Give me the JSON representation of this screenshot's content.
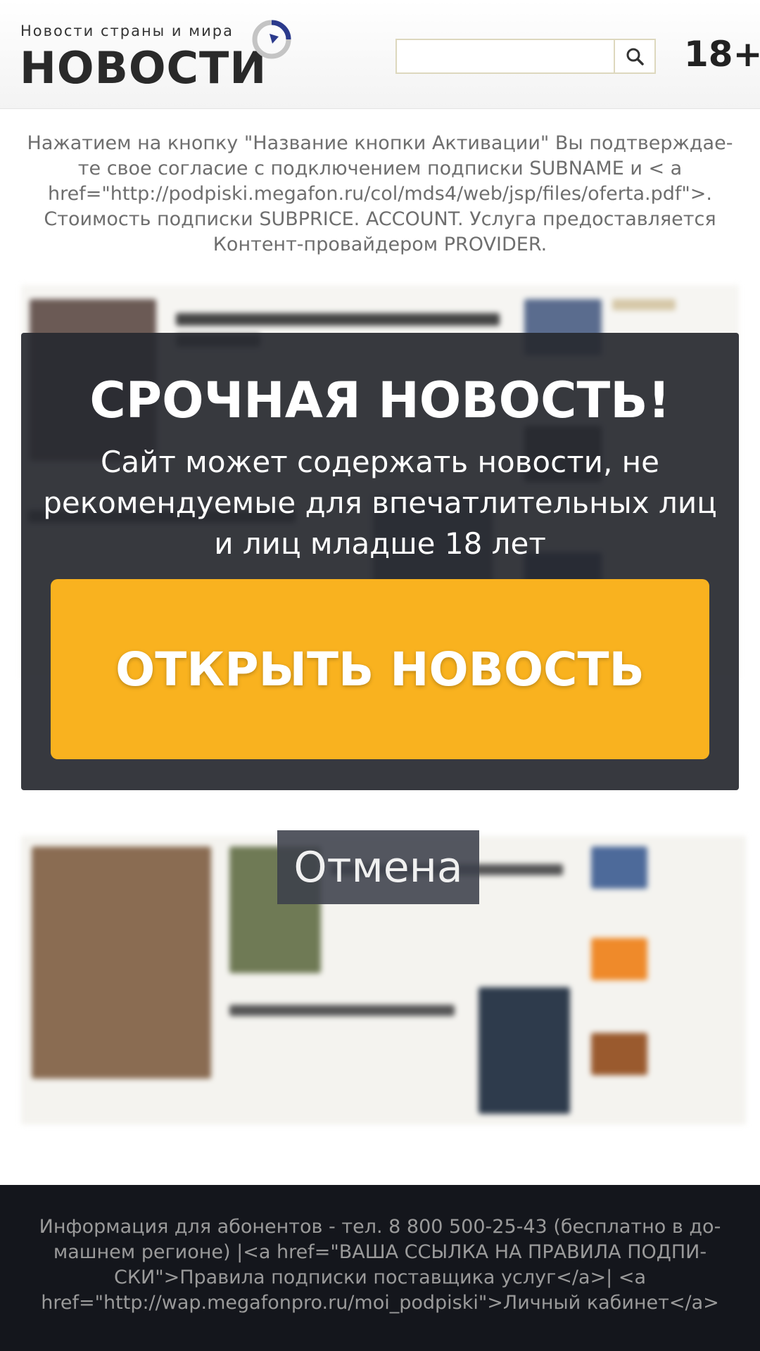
{
  "header": {
    "logo_subtitle": "Новости страны и мира",
    "logo_title": "НОВОСТИ",
    "search": {
      "placeholder": ""
    },
    "age_badge": "18+"
  },
  "disclaimer": "Нажатием на кнопку \"Название кнопки Активации\" Вы подтверждае-те свое согласие с подключением подписки SUBNAME и < a href=\"http://podpiski.megafon.ru/col/mds4/web/jsp/files/oferta.pdf\">. Стоимость подписки SUBPRICE. ACCOUNT. Услуга предоставляется Контент-провайдером PROVIDER.",
  "overlay": {
    "title": "СРОЧНАЯ НОВОСТЬ!",
    "text": "Сайт может содержать новости, не рекомендуемые для впечатлительных лиц и лиц младше 18 лет",
    "open_button": "ОТКРЫТЬ НОВОСТЬ"
  },
  "cancel_button": "Отмена",
  "footer": {
    "text": "Информация для абонентов - тел. 8 800 500-25-43 (бесплатно в до-машнем регионе) |<a href=\"ВАША ССЫЛКА НА ПРАВИЛА ПОДПИ-СКИ\">Правила подписки поставщика услуг</a>| <a href=\"http://wap.megafonpro.ru/moi_podpiski\">Личный кабинет</a>"
  },
  "colors": {
    "accent_button": "#f9b21f",
    "overlay_bg": "#282a30",
    "footer_bg": "#14161c",
    "logo_mark_blue": "#2b3a8c"
  }
}
